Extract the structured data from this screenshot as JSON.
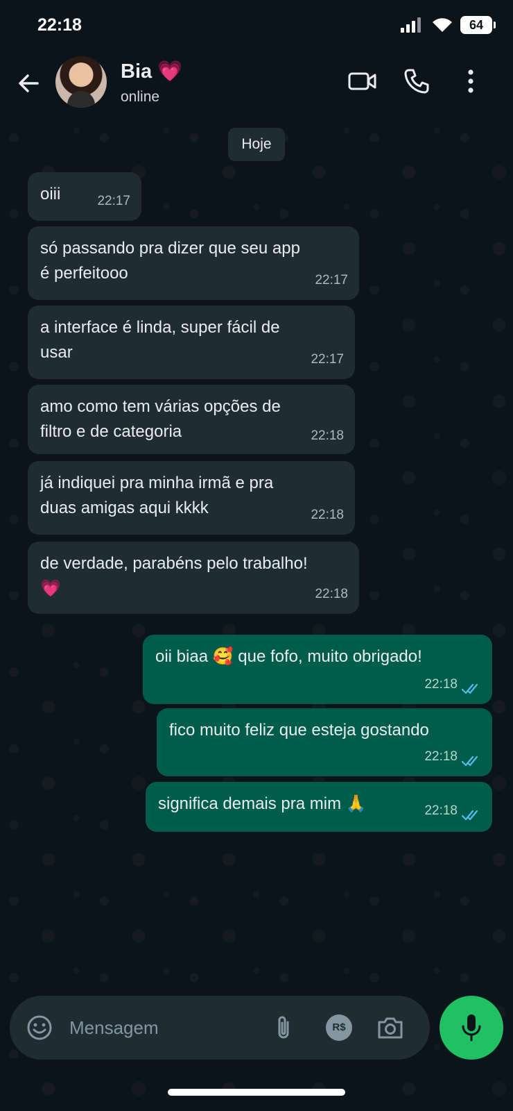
{
  "status_bar": {
    "time": "22:18",
    "battery": "64",
    "icons": [
      "signal-icon",
      "wifi-icon",
      "battery-icon"
    ]
  },
  "header": {
    "contact_name": "Bia",
    "name_emoji": "💗",
    "status": "online",
    "icons": [
      "back-arrow-icon",
      "video-call-icon",
      "phone-icon",
      "more-vert-icon"
    ]
  },
  "chat": {
    "date_label": "Hoje",
    "messages": [
      {
        "direction": "in",
        "lines": [
          "oiii"
        ],
        "time": "22:17"
      },
      {
        "direction": "in",
        "lines": [
          "só passando pra dizer que seu app",
          "é perfeitooo"
        ],
        "time": "22:17"
      },
      {
        "direction": "in",
        "lines": [
          "a interface é linda, super fácil de",
          "usar"
        ],
        "time": "22:17"
      },
      {
        "direction": "in",
        "lines": [
          "amo como tem várias opções de",
          "filtro e de categoria"
        ],
        "time": "22:18"
      },
      {
        "direction": "in",
        "lines": [
          "já indiquei pra minha irmã e pra",
          "duas amigas aqui kkkk"
        ],
        "time": "22:18"
      },
      {
        "direction": "in",
        "lines": [
          "de verdade, parabéns pelo trabalho!",
          "💗"
        ],
        "time": "22:18"
      },
      {
        "direction": "out",
        "lines": [
          "oii biaa 🥰 que fofo, muito obrigado!"
        ],
        "time": "22:18",
        "read": true
      },
      {
        "direction": "out",
        "lines": [
          "fico muito feliz que esteja gostando"
        ],
        "time": "22:18",
        "read": true
      },
      {
        "direction": "out",
        "lines": [
          "significa demais pra mim 🙏"
        ],
        "time": "22:18",
        "read": true
      }
    ]
  },
  "composer": {
    "placeholder": "Mensagem",
    "icons": [
      "emoji-icon",
      "attach-icon",
      "payment-icon",
      "camera-icon",
      "mic-icon"
    ],
    "payment_label": "R$"
  },
  "colors": {
    "background": "#0b141a",
    "incoming_bubble": "#202c33",
    "outgoing_bubble": "#005c4b",
    "read_ticks": "#53bdeb",
    "mic_button": "#21c063"
  }
}
